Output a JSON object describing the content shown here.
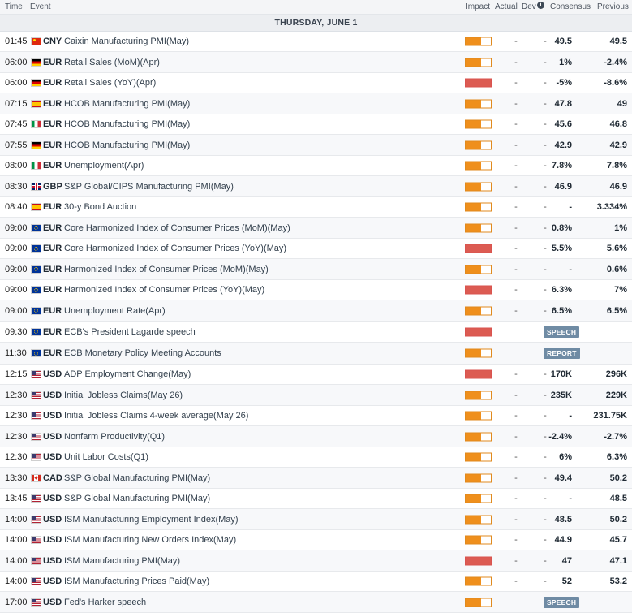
{
  "header": {
    "time": "Time",
    "event": "Event",
    "impact": "Impact",
    "actual": "Actual",
    "dev": "Dev",
    "dev_icon": "info-icon",
    "consensus": "Consensus",
    "previous": "Previous"
  },
  "day_label": "THURSDAY, JUNE 1",
  "colors": {
    "impact_medium": "#ef8f1c",
    "impact_high": "#dc5b52",
    "badge": "#6f8ba4"
  },
  "rows": [
    {
      "time": "01:45",
      "flag": "cn",
      "currency": "CNY",
      "event": "Caixin Manufacturing PMI(May)",
      "impact": "medium",
      "impact_level": 0.6,
      "actual": "-",
      "dev": "-",
      "consensus": "49.5",
      "previous": "49.5"
    },
    {
      "time": "06:00",
      "flag": "de",
      "currency": "EUR",
      "event": "Retail Sales (MoM)(Apr)",
      "impact": "medium",
      "impact_level": 0.6,
      "actual": "-",
      "dev": "-",
      "consensus": "1%",
      "previous": "-2.4%"
    },
    {
      "time": "06:00",
      "flag": "de",
      "currency": "EUR",
      "event": "Retail Sales (YoY)(Apr)",
      "impact": "high",
      "impact_level": 1,
      "actual": "-",
      "dev": "-",
      "consensus": "-5%",
      "previous": "-8.6%"
    },
    {
      "time": "07:15",
      "flag": "es",
      "currency": "EUR",
      "event": "HCOB Manufacturing PMI(May)",
      "impact": "medium",
      "impact_level": 0.6,
      "actual": "-",
      "dev": "-",
      "consensus": "47.8",
      "previous": "49"
    },
    {
      "time": "07:45",
      "flag": "it",
      "currency": "EUR",
      "event": "HCOB Manufacturing PMI(May)",
      "impact": "medium",
      "impact_level": 0.6,
      "actual": "-",
      "dev": "-",
      "consensus": "45.6",
      "previous": "46.8"
    },
    {
      "time": "07:55",
      "flag": "de",
      "currency": "EUR",
      "event": "HCOB Manufacturing PMI(May)",
      "impact": "medium",
      "impact_level": 0.6,
      "actual": "-",
      "dev": "-",
      "consensus": "42.9",
      "previous": "42.9"
    },
    {
      "time": "08:00",
      "flag": "it",
      "currency": "EUR",
      "event": "Unemployment(Apr)",
      "impact": "medium",
      "impact_level": 0.6,
      "actual": "-",
      "dev": "-",
      "consensus": "7.8%",
      "previous": "7.8%"
    },
    {
      "time": "08:30",
      "flag": "gb",
      "currency": "GBP",
      "event": "S&P Global/CIPS Manufacturing PMI(May)",
      "impact": "medium",
      "impact_level": 0.6,
      "actual": "-",
      "dev": "-",
      "consensus": "46.9",
      "previous": "46.9"
    },
    {
      "time": "08:40",
      "flag": "es",
      "currency": "EUR",
      "event": "30-y Bond Auction",
      "impact": "medium",
      "impact_level": 0.6,
      "actual": "-",
      "dev": "-",
      "consensus": "-",
      "previous": "3.334%"
    },
    {
      "time": "09:00",
      "flag": "eu",
      "currency": "EUR",
      "event": "Core Harmonized Index of Consumer Prices (MoM)(May)",
      "impact": "medium",
      "impact_level": 0.6,
      "actual": "-",
      "dev": "-",
      "consensus": "0.8%",
      "previous": "1%"
    },
    {
      "time": "09:00",
      "flag": "eu",
      "currency": "EUR",
      "event": "Core Harmonized Index of Consumer Prices (YoY)(May)",
      "impact": "high",
      "impact_level": 1,
      "actual": "-",
      "dev": "-",
      "consensus": "5.5%",
      "previous": "5.6%"
    },
    {
      "time": "09:00",
      "flag": "eu",
      "currency": "EUR",
      "event": "Harmonized Index of Consumer Prices (MoM)(May)",
      "impact": "medium",
      "impact_level": 0.6,
      "actual": "-",
      "dev": "-",
      "consensus": "-",
      "previous": "0.6%"
    },
    {
      "time": "09:00",
      "flag": "eu",
      "currency": "EUR",
      "event": "Harmonized Index of Consumer Prices (YoY)(May)",
      "impact": "high",
      "impact_level": 1,
      "actual": "-",
      "dev": "-",
      "consensus": "6.3%",
      "previous": "7%"
    },
    {
      "time": "09:00",
      "flag": "eu",
      "currency": "EUR",
      "event": "Unemployment Rate(Apr)",
      "impact": "medium",
      "impact_level": 0.6,
      "actual": "-",
      "dev": "-",
      "consensus": "6.5%",
      "previous": "6.5%"
    },
    {
      "time": "09:30",
      "flag": "eu",
      "currency": "EUR",
      "event": "ECB's President Lagarde speech",
      "impact": "high",
      "impact_level": 1,
      "badge": "SPEECH"
    },
    {
      "time": "11:30",
      "flag": "eu",
      "currency": "EUR",
      "event": "ECB Monetary Policy Meeting Accounts",
      "impact": "medium",
      "impact_level": 0.6,
      "badge": "REPORT"
    },
    {
      "time": "12:15",
      "flag": "us",
      "currency": "USD",
      "event": "ADP Employment Change(May)",
      "impact": "high",
      "impact_level": 1,
      "actual": "-",
      "dev": "-",
      "consensus": "170K",
      "previous": "296K"
    },
    {
      "time": "12:30",
      "flag": "us",
      "currency": "USD",
      "event": "Initial Jobless Claims(May 26)",
      "impact": "medium",
      "impact_level": 0.6,
      "actual": "-",
      "dev": "-",
      "consensus": "235K",
      "previous": "229K"
    },
    {
      "time": "12:30",
      "flag": "us",
      "currency": "USD",
      "event": "Initial Jobless Claims 4-week average(May 26)",
      "impact": "medium",
      "impact_level": 0.6,
      "actual": "-",
      "dev": "-",
      "consensus": "-",
      "previous": "231.75K"
    },
    {
      "time": "12:30",
      "flag": "us",
      "currency": "USD",
      "event": "Nonfarm Productivity(Q1)",
      "impact": "medium",
      "impact_level": 0.6,
      "actual": "-",
      "dev": "-",
      "consensus": "-2.4%",
      "previous": "-2.7%"
    },
    {
      "time": "12:30",
      "flag": "us",
      "currency": "USD",
      "event": "Unit Labor Costs(Q1)",
      "impact": "medium",
      "impact_level": 0.6,
      "actual": "-",
      "dev": "-",
      "consensus": "6%",
      "previous": "6.3%"
    },
    {
      "time": "13:30",
      "flag": "ca",
      "currency": "CAD",
      "event": "S&P Global Manufacturing PMI(May)",
      "impact": "medium",
      "impact_level": 0.6,
      "actual": "-",
      "dev": "-",
      "consensus": "49.4",
      "previous": "50.2"
    },
    {
      "time": "13:45",
      "flag": "us",
      "currency": "USD",
      "event": "S&P Global Manufacturing PMI(May)",
      "impact": "medium",
      "impact_level": 0.6,
      "actual": "-",
      "dev": "-",
      "consensus": "-",
      "previous": "48.5"
    },
    {
      "time": "14:00",
      "flag": "us",
      "currency": "USD",
      "event": "ISM Manufacturing Employment Index(May)",
      "impact": "medium",
      "impact_level": 0.6,
      "actual": "-",
      "dev": "-",
      "consensus": "48.5",
      "previous": "50.2"
    },
    {
      "time": "14:00",
      "flag": "us",
      "currency": "USD",
      "event": "ISM Manufacturing New Orders Index(May)",
      "impact": "medium",
      "impact_level": 0.6,
      "actual": "-",
      "dev": "-",
      "consensus": "44.9",
      "previous": "45.7"
    },
    {
      "time": "14:00",
      "flag": "us",
      "currency": "USD",
      "event": "ISM Manufacturing PMI(May)",
      "impact": "high",
      "impact_level": 1,
      "actual": "-",
      "dev": "-",
      "consensus": "47",
      "previous": "47.1"
    },
    {
      "time": "14:00",
      "flag": "us",
      "currency": "USD",
      "event": "ISM Manufacturing Prices Paid(May)",
      "impact": "medium",
      "impact_level": 0.6,
      "actual": "-",
      "dev": "-",
      "consensus": "52",
      "previous": "53.2"
    },
    {
      "time": "17:00",
      "flag": "us",
      "currency": "USD",
      "event": "Fed's Harker speech",
      "impact": "medium",
      "impact_level": 0.6,
      "badge": "SPEECH"
    }
  ]
}
